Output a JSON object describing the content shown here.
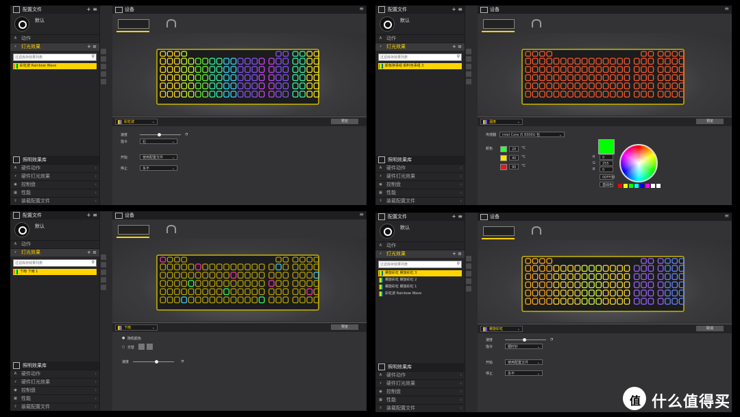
{
  "common": {
    "profiles_title": "配置文件",
    "profile_name": "默认",
    "actions": "动作",
    "lighting": "灯光效果",
    "search_placeholder": "过滤库存效果列表",
    "library": "照明效果库",
    "hardware_actions": "硬件动作",
    "hardware_lighting": "硬件灯光效果",
    "dashboard": "控制盘",
    "performance": "性能",
    "import_profile": "装载配置文件",
    "devices_title": "设备",
    "menu_icon": "menu-icon",
    "accent": "#ffd400"
  },
  "panels": [
    {
      "effects": [
        {
          "label": "彩虹波 Rainbow Wave",
          "selected": true
        }
      ],
      "toolbar_label": "彩虹波",
      "preview": "预览",
      "keycolor": "rainbow",
      "settings": {
        "speed": "速度",
        "direction": "指令",
        "direction_val": "右",
        "start": "开始",
        "start_val": "使用配置文件",
        "stop": "停止",
        "stop_val": "永不"
      }
    },
    {
      "effects": [
        {
          "label": "颜板换事组 颜料色事组 3",
          "selected": true
        }
      ],
      "toolbar_label": "温度",
      "preview": "预览",
      "keycolor": "#ff5a2a",
      "settings": {
        "sensor": "传感器",
        "sensor_val": "Intel Core i5 8300U 包",
        "color": "颜色",
        "t1": "20",
        "t2": "40",
        "t3": "90",
        "unit": "°C",
        "rgb_labels": [
          "R",
          "G",
          "B"
        ],
        "rgb": [
          "0",
          "255",
          "0"
        ],
        "hex": "00FF00",
        "hex_btn": "基础色"
      }
    },
    {
      "effects": [
        {
          "label": "下雨 下雨 1",
          "selected": true
        }
      ],
      "toolbar_label": "下雨",
      "preview": "预览",
      "keycolor": "mixed",
      "settings": {
        "random": "随机颜色",
        "alternate": "交替",
        "speed": "速度"
      }
    },
    {
      "effects": [
        {
          "label": "螺旋彩虹 螺旋彩虹 3",
          "selected": true
        },
        {
          "label": "螺旋彩虹 螺旋彩虹 2",
          "selected": false
        },
        {
          "label": "螺旋彩虹 螺旋彩虹 1",
          "selected": false
        },
        {
          "label": "彩虹波 Rainbow Wave",
          "selected": false
        }
      ],
      "toolbar_label": "螺旋彩虹",
      "preview": "取消",
      "keycolor": "spiral",
      "settings": {
        "speed": "速度",
        "direction": "指令",
        "direction_val": "顺时针",
        "start": "开始",
        "start_val": "使用配置文件",
        "stop": "停止",
        "stop_val": "永不"
      }
    }
  ],
  "watermark": {
    "logo_char": "值",
    "text": "什么值得买"
  }
}
